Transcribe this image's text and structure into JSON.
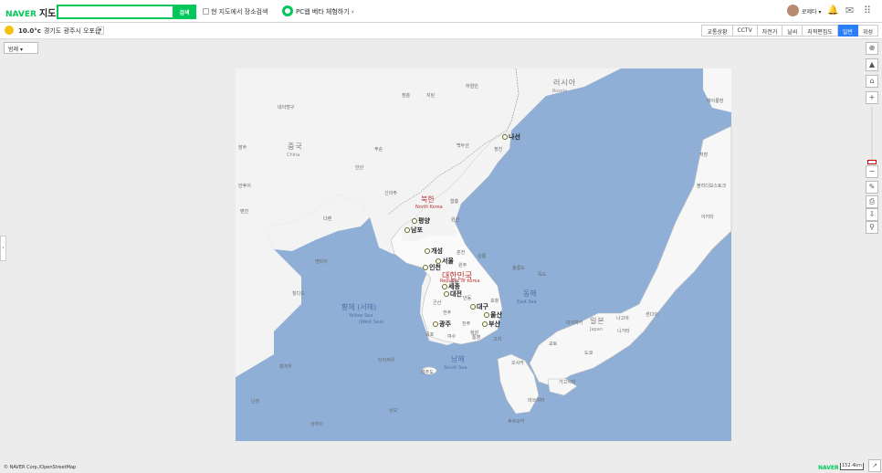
{
  "header": {
    "brand": "NAVER",
    "service": "지도",
    "search_placeholder": "",
    "search_button": "검색",
    "checkbox_label": "현 지도에서 장소검색",
    "beta_label": "PC웹 베타 체험하기 ›",
    "username": "로제타 ▾"
  },
  "subbar": {
    "weather_temp": "10.0°c",
    "weather_location": "경기도 광주시 오포읍",
    "weather_dropdown": "▾",
    "tabs": [
      "교통상황",
      "CCTV",
      "자전거",
      "날씨",
      "지적편집도",
      "일반",
      "위성"
    ],
    "active_tab": "일반"
  },
  "map": {
    "layer_select": "범례 ▾",
    "side_handle": "›",
    "countries": [
      {
        "name": "러시아",
        "sub": "Russia"
      },
      {
        "name": "중국",
        "sub": "China"
      },
      {
        "name": "북한",
        "sub": "North Korea"
      },
      {
        "name": "대한민국",
        "sub": "Republic of Korea"
      },
      {
        "name": "일본",
        "sub": "Japan"
      }
    ],
    "seas": [
      {
        "name": "황해 (서해)",
        "sub": "Yellow Sea",
        "sub2": "(West Sea)"
      },
      {
        "name": "동해",
        "sub": "East Sea"
      },
      {
        "name": "남해",
        "sub": "South Sea"
      }
    ],
    "major_cities": [
      "나선",
      "평양",
      "남포",
      "개성",
      "서울",
      "인천",
      "세종",
      "대전",
      "대구",
      "울산",
      "광주",
      "부산"
    ],
    "minor_places": [
      "장춘",
      "지린",
      "하얼빈",
      "네이멍구",
      "푸순",
      "안산",
      "톈진",
      "다롄",
      "칭다오",
      "옌타이",
      "헤이룽장",
      "백두산",
      "청진",
      "원산",
      "함흥",
      "신의주",
      "춘천",
      "원주",
      "강릉",
      "울릉도",
      "독도",
      "안동",
      "포항",
      "청주",
      "군산",
      "전주",
      "진주",
      "창원",
      "목포",
      "여수",
      "제주도",
      "통영",
      "상하이",
      "난징",
      "항저우",
      "닝보",
      "타이저우",
      "장쑤",
      "안후이",
      "저장",
      "블라디보스토크",
      "아키타",
      "센다이",
      "니가타",
      "도쿄",
      "나고야",
      "오사카",
      "교토",
      "후쿠오카",
      "마쓰야마",
      "가고시마",
      "미야자키",
      "고치",
      "돗토리",
      "쓰시마"
    ],
    "controls": [
      "⊕",
      "▲",
      "⌂",
      "+",
      "−",
      "✎",
      "⎙",
      "⇩",
      "⚲"
    ],
    "scale_label": "152.4km"
  },
  "footer": {
    "copyright": "© NAVER Corp./OpenStreetMap",
    "logo": "NAVER",
    "corner": "↗"
  },
  "colors": {
    "brand_green": "#03c75a",
    "sea_blue": "#8fafd6",
    "land": "#f7f7f7",
    "active_tab": "#2a7ef7"
  }
}
